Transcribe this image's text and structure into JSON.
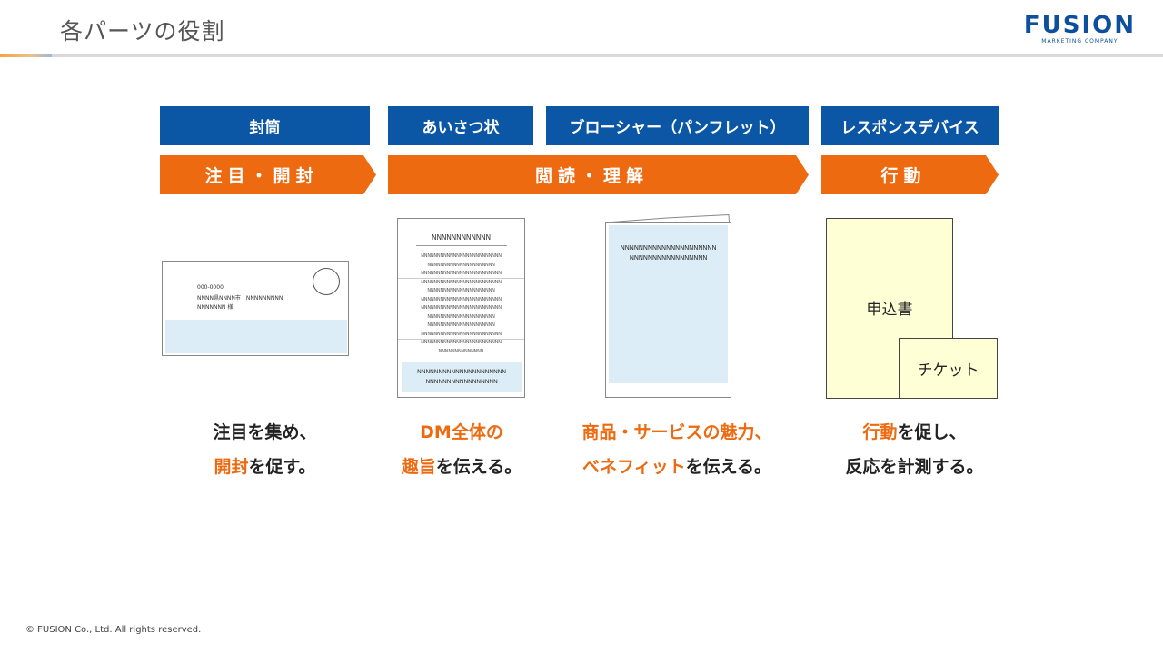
{
  "page": {
    "title": "各パーツの役割"
  },
  "logo": {
    "main": "FUSION",
    "sub": "MARKETING COMPANY"
  },
  "headers": [
    "封筒",
    "あいさつ状",
    "ブローシャー（パンフレット）",
    "レスポンスデバイス"
  ],
  "phases": [
    "注目・開封",
    "閲読・理解",
    "行動"
  ],
  "envelope": {
    "zip": "000-0000",
    "address": "NNNN県NNNN市　NNNNNNNNN",
    "recipient": "NNNNNNN 様"
  },
  "letter": {
    "heading": "NNNNNNNNNNNN",
    "lines": [
      "NNNNNNNNNNNNNNNNNNNNNNNNN",
      "NNNNNNNNNNNNNNNNNNNNN",
      "NNNNNNNNNNNNNNNNNNNNNNNNN",
      "NNNNNNNNNNNNNNNNNNNNNNNNN",
      "NNNNNNNNNNNNNNNNNNNNN",
      "NNNNNNNNNNNNNNNNNNNNNNNNN",
      "NNNNNNNNNNNNNNNNNNNNNNNNN",
      "NNNNNNNNNNNNNNNNNNNNN",
      "NNNNNNNNNNNNNNNNNNNNN",
      "NNNNNNNNNNNNNNNNNNNNNNNNN",
      "NNNNNNNNNNNNNNNNNNNNNNNNN",
      "NNNNNNNNNNNNNN"
    ],
    "box_line1": "NNNNNNNNNNNNNNNNNNNNN",
    "box_line2": "NNNNNNNNNNNNNNNNN"
  },
  "brochure": {
    "line1": "NNNNNNNNNNNNNNNNNNNNN",
    "line2": "NNNNNNNNNNNNNNNNN"
  },
  "response": {
    "form": "申込書",
    "ticket": "チケット"
  },
  "descriptions": [
    {
      "line1_pre": "",
      "line1_hl": "",
      "line1_post": "注目を集め、",
      "line2_hl": "開封",
      "line2_post": "を促す。"
    },
    {
      "line1_pre": "",
      "line1_hl": "DM全体の",
      "line1_post": "",
      "line2_hl": "趣旨",
      "line2_post": "を伝える。"
    },
    {
      "line1_pre": "",
      "line1_hl": "商品・サービスの魅力、",
      "line1_post": "",
      "line2_hl": "ベネフィット",
      "line2_post": "を伝える。"
    },
    {
      "line1_pre": "",
      "line1_hl": "行動",
      "line1_post": "を促し、",
      "line2_hl": "",
      "line2_post": "反応を計測する。"
    }
  ],
  "footer": {
    "copyright": "© FUSION Co., Ltd. All rights reserved."
  },
  "colors": {
    "blue": "#0b56a5",
    "orange": "#ee6a10",
    "lightblue": "#dcedf8",
    "paper_yellow": "#ffffd6"
  }
}
